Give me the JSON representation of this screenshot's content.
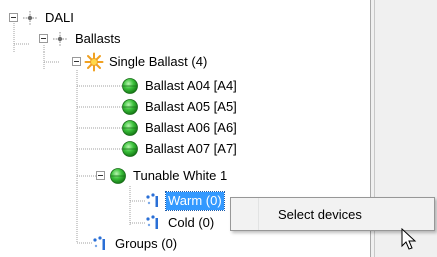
{
  "tree": {
    "nodes": [
      {
        "id": "dali",
        "label": "DALI",
        "icon": "network-icon"
      },
      {
        "id": "ballasts",
        "label": "Ballasts",
        "icon": "network-icon"
      },
      {
        "id": "single-ballast",
        "label": "Single Ballast (4)",
        "icon": "light-burst-icon"
      },
      {
        "id": "ballast-a04",
        "label": "Ballast A04 [A4]",
        "icon": "green-ball-icon"
      },
      {
        "id": "ballast-a05",
        "label": "Ballast A05 [A5]",
        "icon": "green-ball-icon"
      },
      {
        "id": "ballast-a06",
        "label": "Ballast A06 [A6]",
        "icon": "green-ball-icon"
      },
      {
        "id": "ballast-a07",
        "label": "Ballast A07 [A7]",
        "icon": "green-ball-icon"
      },
      {
        "id": "tunable-white",
        "label": "Tunable White 1",
        "icon": "green-ball-icon"
      },
      {
        "id": "warm",
        "label": "Warm (0)",
        "icon": "group-icon",
        "selected": true
      },
      {
        "id": "cold",
        "label": "Cold (0)",
        "icon": "group-icon"
      },
      {
        "id": "groups",
        "label": "Groups (0)",
        "icon": "group-icon"
      }
    ]
  },
  "context_menu": {
    "items": [
      {
        "label": "Select devices"
      }
    ]
  },
  "colors": {
    "selection": "#3399ff",
    "ball_green": "#2fb52f"
  }
}
